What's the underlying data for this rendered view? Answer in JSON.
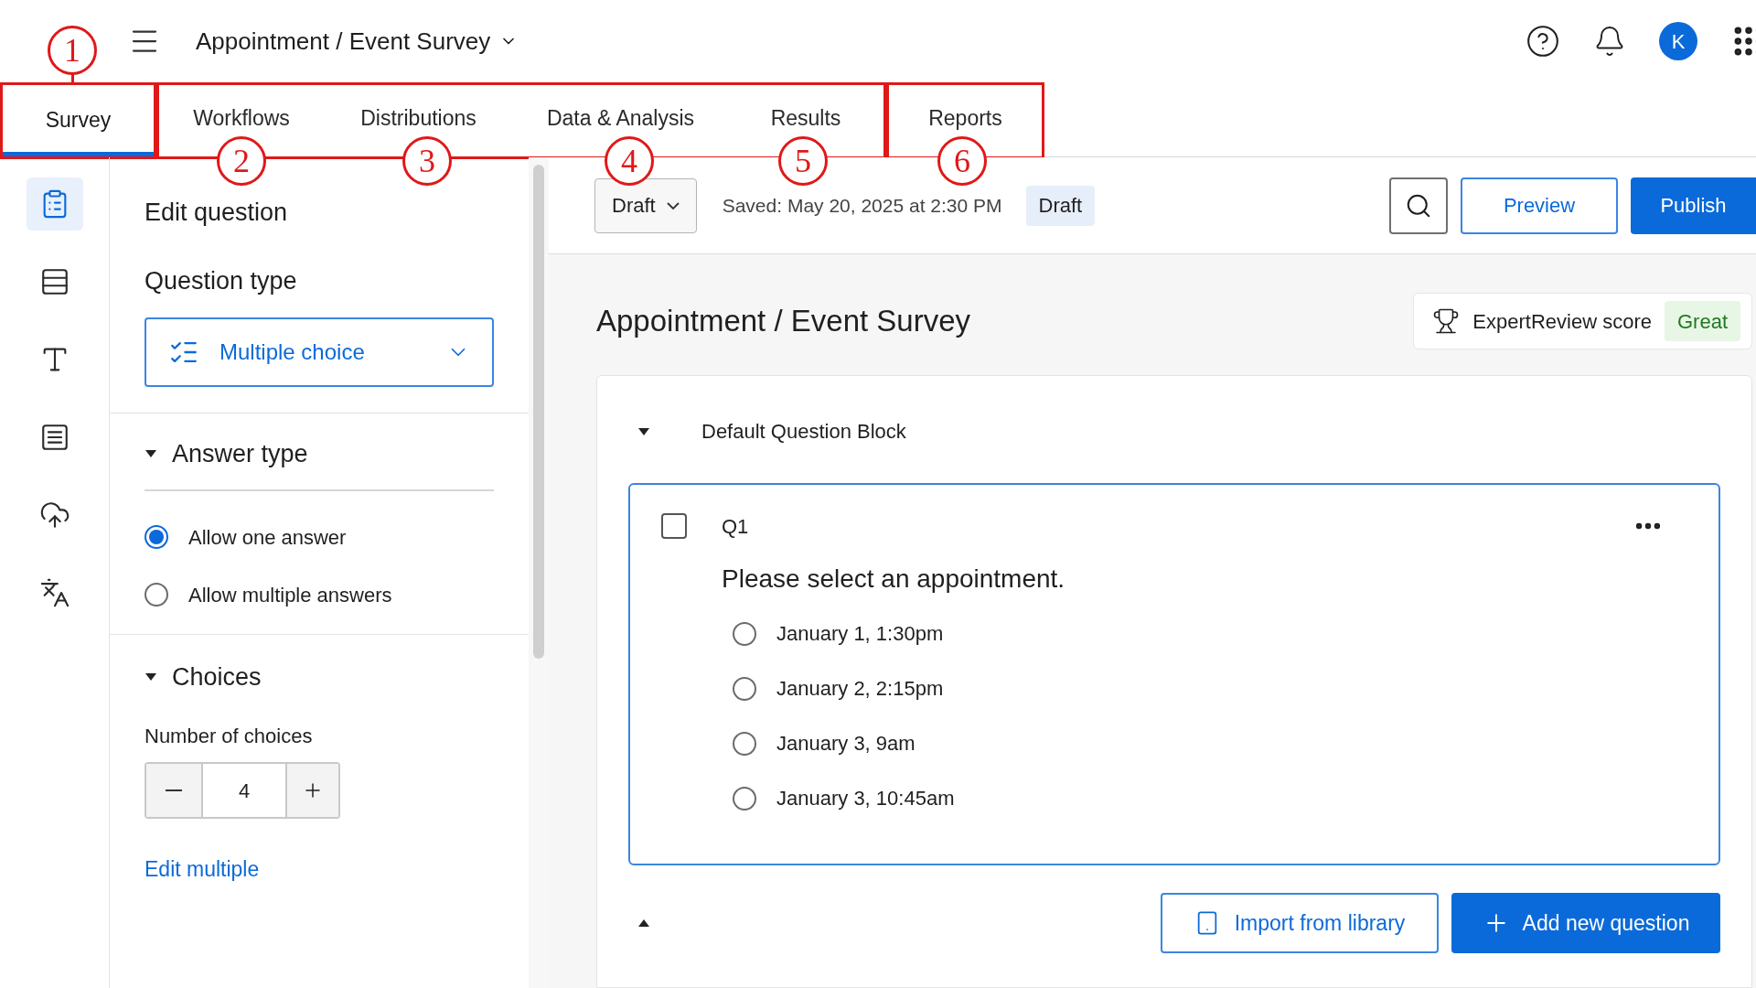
{
  "header": {
    "title": "Appointment / Event Survey",
    "avatar": "K"
  },
  "tabs": [
    {
      "label": "Survey",
      "selected": true
    },
    {
      "label": "Workflows",
      "selected": false
    },
    {
      "label": "Distributions",
      "selected": false
    },
    {
      "label": "Data & Analysis",
      "selected": false
    },
    {
      "label": "Results",
      "selected": false
    },
    {
      "label": "Reports",
      "selected": false
    }
  ],
  "annotations": [
    "1",
    "2",
    "3",
    "4",
    "5",
    "6"
  ],
  "rail_items": [
    {
      "selected": true
    },
    {
      "selected": false
    },
    {
      "selected": false
    },
    {
      "selected": false
    },
    {
      "selected": false
    },
    {
      "selected": false
    }
  ],
  "edit_panel": {
    "title": "Edit question",
    "question_type_label": "Question type",
    "question_type": "Multiple choice",
    "answer_type": {
      "title": "Answer type",
      "expanded": true,
      "options": [
        {
          "label": "Allow one answer",
          "selected": true
        },
        {
          "label": "Allow multiple answers",
          "selected": false
        }
      ]
    },
    "choices": {
      "title": "Choices",
      "expanded": true,
      "count_label": "Number of choices",
      "count": "4",
      "edit_link": "Edit multiple"
    }
  },
  "toolbar": {
    "version": "Draft",
    "saved": "Saved: May 20, 2025 at 2:30 PM",
    "status": "Draft",
    "preview": "Preview",
    "publish": "Publish"
  },
  "survey": {
    "title": "Appointment / Event Survey",
    "score_label": "ExpertReview score",
    "score": "Great"
  },
  "block": {
    "title": "Default Question Block",
    "expanded": true,
    "question": {
      "number": "Q1",
      "checked": false,
      "text": "Please select an appointment.",
      "choices": [
        {
          "label": "January 1, 1:30pm",
          "selected": false
        },
        {
          "label": "January 2, 2:15pm",
          "selected": false
        },
        {
          "label": "January 3, 9am",
          "selected": false
        },
        {
          "label": "January 3, 10:45am",
          "selected": false
        }
      ]
    },
    "import": "Import from library",
    "add": "Add new question"
  }
}
